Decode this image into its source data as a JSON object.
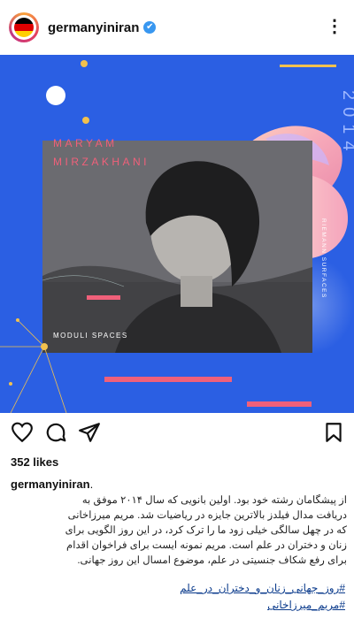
{
  "post": {
    "username": "germanyiniran",
    "verified_glyph": "✔",
    "more_glyph": "⋮",
    "image": {
      "title_line1": "MARYAM",
      "title_line2": "MIRZAKHANI",
      "year_text": "2014",
      "vertical_label": "RIEMANN SURFACES",
      "bottom_label": "MODULI SPACES"
    },
    "likes": "352 likes",
    "author_line": "germanyiniran",
    "author_dot": ".",
    "caption_lines": [
      "از پیشگامان رشته خود بود. اولین بانویی که سال ۲۰۱۴ موفق به",
      "دریافت مدال فیلدز بالاترین جایزه در ریاضیات شد. مریم میرزاخانی",
      "که در چهل سالگی خیلی زود ما را ترک کرد، در این روز الگویی برای",
      "زنان و دختران در علم است. مریم نمونه ایست برای فراخوان اقدام",
      "برای رفع شکاف جنسیتی در علم، موضوع امسال  این روز جهانی."
    ],
    "hashtags": [
      "#روز_جهانی_زنان_و_دختران_در_علم",
      "#مریم_میرزاخانی"
    ]
  },
  "colors": {
    "poster_blue": "#2b5fe3",
    "accent_pink": "#f0607a",
    "accent_yellow": "#f2c14e",
    "verified_blue": "#3897f0"
  },
  "icons": {
    "like": "heart-icon",
    "comment": "comment-icon",
    "share": "send-icon",
    "save": "bookmark-icon"
  }
}
